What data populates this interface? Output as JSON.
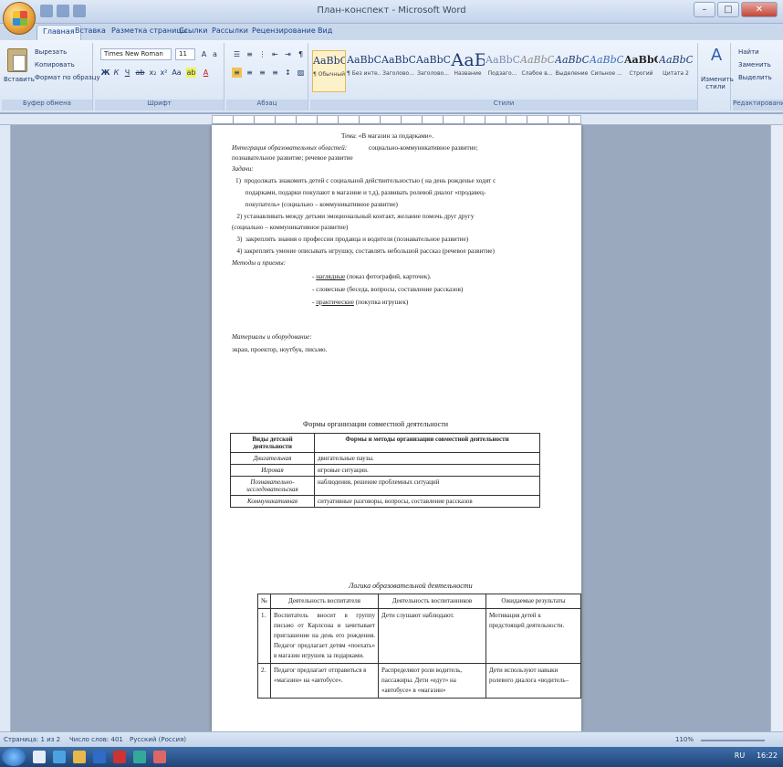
{
  "window": {
    "title": "План-конспект - Microsoft Word"
  },
  "tabs": [
    "Главная",
    "Вставка",
    "Разметка страницы",
    "Ссылки",
    "Рассылки",
    "Рецензирование",
    "Вид"
  ],
  "ribbon": {
    "clipboard": {
      "paste_label": "Вставить",
      "cut": "Вырезать",
      "copy": "Копировать",
      "format_painter": "Формат по образцу",
      "group": "Буфер обмена"
    },
    "font": {
      "font_name": "Times New Roman",
      "font_size": "11",
      "group": "Шрифт"
    },
    "paragraph": {
      "group": "Абзац"
    },
    "styles": {
      "group": "Стили",
      "items": [
        {
          "sample": "AaBbCcI",
          "name": "¶ Обычный"
        },
        {
          "sample": "AaBbCcI",
          "name": "¶ Без инте..."
        },
        {
          "sample": "AaBbC",
          "name": "Заголово..."
        },
        {
          "sample": "AaBbCc",
          "name": "Заголово..."
        },
        {
          "sample": "АаБ",
          "name": "Название"
        },
        {
          "sample": "AaBbCc.",
          "name": "Подзаго..."
        },
        {
          "sample": "AaBbCcD",
          "name": "Слабое в..."
        },
        {
          "sample": "AaBbCcD",
          "name": "Выделение"
        },
        {
          "sample": "AaBbCcD",
          "name": "Сильное ..."
        },
        {
          "sample": "AaBbCcD",
          "name": "Строгий"
        },
        {
          "sample": "AaBbCcI",
          "name": "Цитата 2"
        }
      ],
      "change_styles": "Изменить стили"
    },
    "editing": {
      "find": "Найти",
      "replace": "Заменить",
      "select": "Выделить",
      "group": "Редактирование"
    }
  },
  "document": {
    "theme": "Тема: «В магазин за подарками».",
    "integration_label": "Интеграция образовательных областей:",
    "integration_text": "социально-коммуникативное развитие;",
    "integration_text2": "познавательное развитие; речевое развитие",
    "tasks_label": "Задачи:",
    "tasks": [
      "1)  продолжать знакомить детей с социальной действительностью ( на день рожденье ходят с",
      "      подарками, подарки покупают в магазине и т.д), развивать ролевой диалог «продавец-",
      "      покупатель» (социально – коммуникативное развитие)",
      "   2) устанавливать между детьми эмоциональный контакт, желание помочь друг другу",
      "(социально – коммуникативное развитие)",
      "   3)  закреплять знания о профессии продавца и водителя (познавательное развитие)",
      "   4) закреплять умение описывать игрушку, составлять небольшой рассказ (речевое развитие)"
    ],
    "methods_label": "Методы и приемы:",
    "methods": [
      {
        "u": "наглядные",
        "rest": " (показ фотографий, карточек)."
      },
      {
        "u": "",
        "rest": "словесные (беседа, вопросы, составление рассказов)"
      },
      {
        "u": "практические",
        "rest": " (покупка игрушек)"
      }
    ],
    "materials_label": "Материалы и оборудование:",
    "materials_text": "экран, проектор, ноутбук, письмо.",
    "table1_title": "Формы организации совместной деятельности",
    "table1_head": [
      "Виды детской деятельности",
      "Формы и методы организации совместной деятельности"
    ],
    "table1_rows": [
      [
        "Двигательная",
        "двигательные паузы."
      ],
      [
        "Игровая",
        "игровые ситуации."
      ],
      [
        "Познавательно-исследовательская",
        "наблюдения, решение проблемных ситуаций"
      ],
      [
        "Коммуникативная",
        "ситуативные разговоры, вопросы, составление рассказов"
      ]
    ],
    "table2_title": "Логика образовательной деятельности",
    "table2_head": [
      "№",
      "Деятельность воспитателя",
      "Деятельность воспитанников",
      "Ожидаемые результаты"
    ],
    "table2_rows": [
      [
        "1.",
        "Воспитатель вносит в группу письмо от Карлсона и зачитывает приглашение на день его рождения. Педагог предлагает детям «поехать» в магазин игрушек за подарками.",
        "Дети слушают наблюдают.",
        "Мотивация детей к предстоящей деятельности."
      ],
      [
        "2.",
        "Педагог предлагает отправиться в «магазин» на «автобусе».",
        "Распределяют роли водитель, пассажиры. Дети «едут» на «автобусе» в «магазин»",
        "Дети используют навыки ролевого диалога «водитель–"
      ]
    ]
  },
  "status": {
    "page": "Страница: 1 из 2",
    "words": "Число слов: 401",
    "lang": "Русский (Россия)",
    "zoom": "110%"
  },
  "taskbar": {
    "lang": "RU",
    "time": "16:22"
  }
}
